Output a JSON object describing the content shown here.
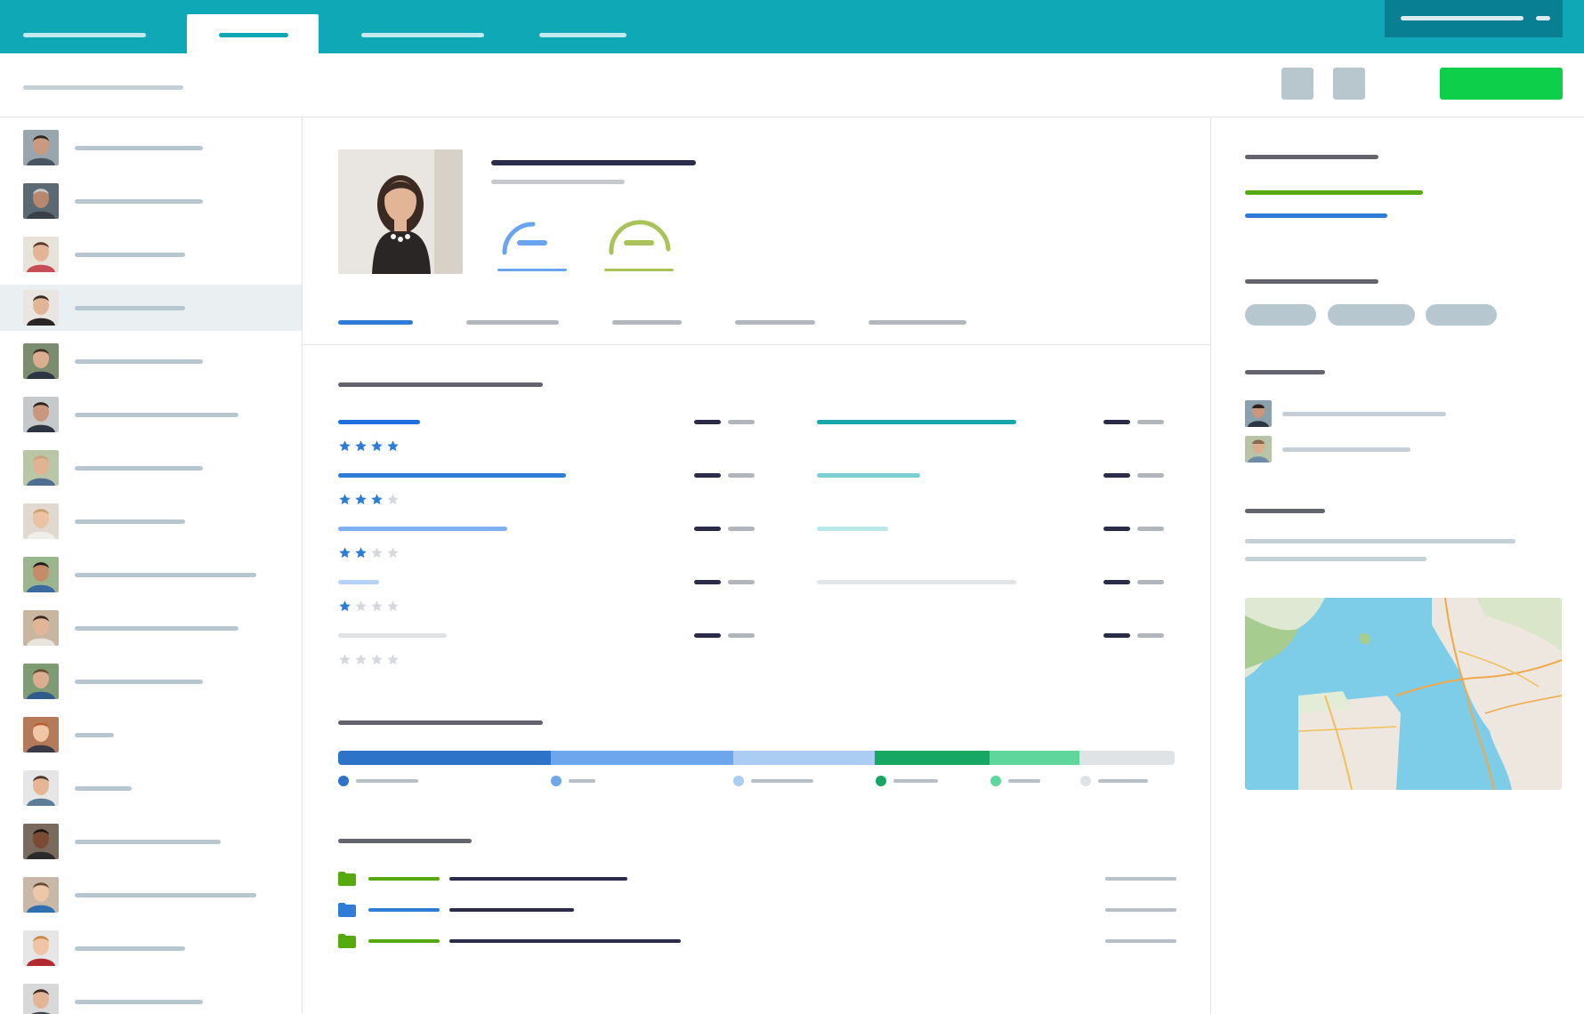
{
  "app": {
    "top_tabs": [
      {
        "id": "tab-1",
        "active": false
      },
      {
        "id": "tab-2",
        "active": true
      },
      {
        "id": "tab-3",
        "active": false
      },
      {
        "id": "tab-4",
        "active": false
      }
    ],
    "account_menu_icon": "chevron-down-icon"
  },
  "toolbar": {
    "tool_icons": [
      "square-icon",
      "square-icon"
    ],
    "primary_action_color": "#0ecf49"
  },
  "sidebar": {
    "selected_index": 3,
    "people_count": 17
  },
  "profile": {
    "gauges": [
      {
        "color": "#6aa3f0",
        "level": 0.55
      },
      {
        "color": "#a9c25a",
        "level": 0.75
      }
    ],
    "active_tab_index": 0
  },
  "skills": {
    "left_column_ratings": [
      4,
      3,
      2,
      1,
      0
    ],
    "max_rating": 4,
    "star_color": "#2e7bd8",
    "star_empty_color": "#d5d9de"
  },
  "allocation": {
    "segments": [
      {
        "share": 0.254,
        "color": "#2d74c8"
      },
      {
        "share": 0.218,
        "color": "#6da6ec"
      },
      {
        "share": 0.17,
        "color": "#abcdf4"
      },
      {
        "share": 0.137,
        "color": "#17a765"
      },
      {
        "share": 0.107,
        "color": "#5fd69c"
      },
      {
        "share": 0.114,
        "color": "#dfe3e6"
      }
    ]
  },
  "files": [
    {
      "icon": "folder-icon",
      "color": "#56aa10"
    },
    {
      "icon": "folder-icon",
      "color": "#2e7bd8"
    },
    {
      "icon": "folder-icon",
      "color": "#56aa10"
    }
  ],
  "details": {
    "chips_count": 3,
    "contacts_count": 2,
    "map": "map-image"
  }
}
